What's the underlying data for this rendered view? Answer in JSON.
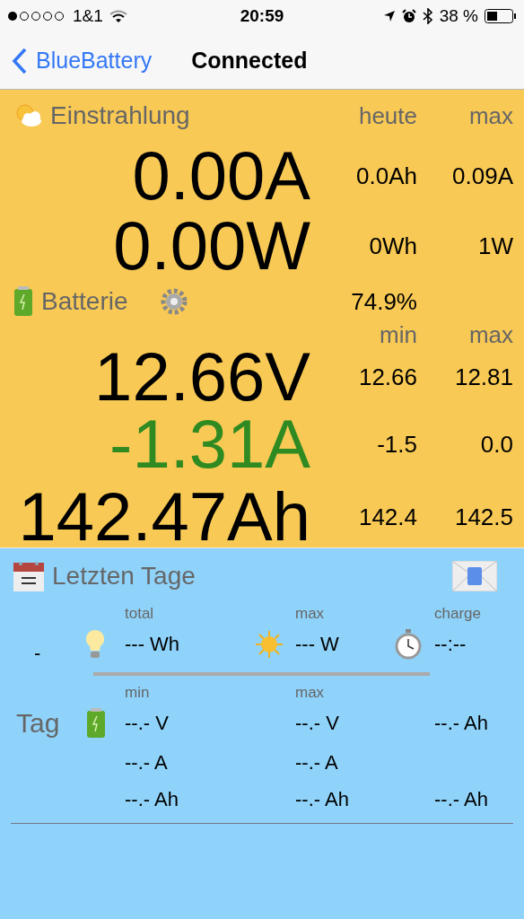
{
  "status_bar": {
    "carrier": "1&1",
    "time": "20:59",
    "battery": "38 %"
  },
  "nav": {
    "back": "BlueBattery",
    "title": "Connected"
  },
  "solar": {
    "title": "Einstrahlung",
    "headings": [
      "heute",
      "max"
    ],
    "rows": [
      {
        "value": "0.00A",
        "today": "0.0Ah",
        "max": "0.09A"
      },
      {
        "value": "0.00W",
        "today": "0Wh",
        "max": "1W"
      }
    ]
  },
  "battery": {
    "title": "Batterie",
    "charge": "74.9%",
    "headings": [
      "min",
      "max"
    ],
    "rows": [
      {
        "value": "12.66V",
        "min": "12.66",
        "max": "12.81",
        "color": "#000000"
      },
      {
        "value": "-1.31A",
        "min": "-1.5",
        "max": "0.0",
        "color": "#2f8a22"
      },
      {
        "value": "142.47Ah",
        "min": "142.4",
        "max": "142.5",
        "color": "#000000"
      }
    ]
  },
  "history": {
    "title": "Letzten Tage",
    "summary": {
      "label": "-",
      "total_label": "total",
      "total": "--- Wh",
      "max_label": "max",
      "max": "--- W",
      "charge_label": "charge",
      "charge": "--:--"
    },
    "day": {
      "label": "Tag",
      "headings": [
        "min",
        "max"
      ],
      "rows": [
        {
          "min": "--.- V",
          "max": "--.- V",
          "extra": "--.- Ah"
        },
        {
          "min": "--.- A",
          "max": "--.- A"
        },
        {
          "min": "--.- Ah",
          "max": "--.- Ah",
          "extra": "--.- Ah"
        }
      ]
    }
  }
}
